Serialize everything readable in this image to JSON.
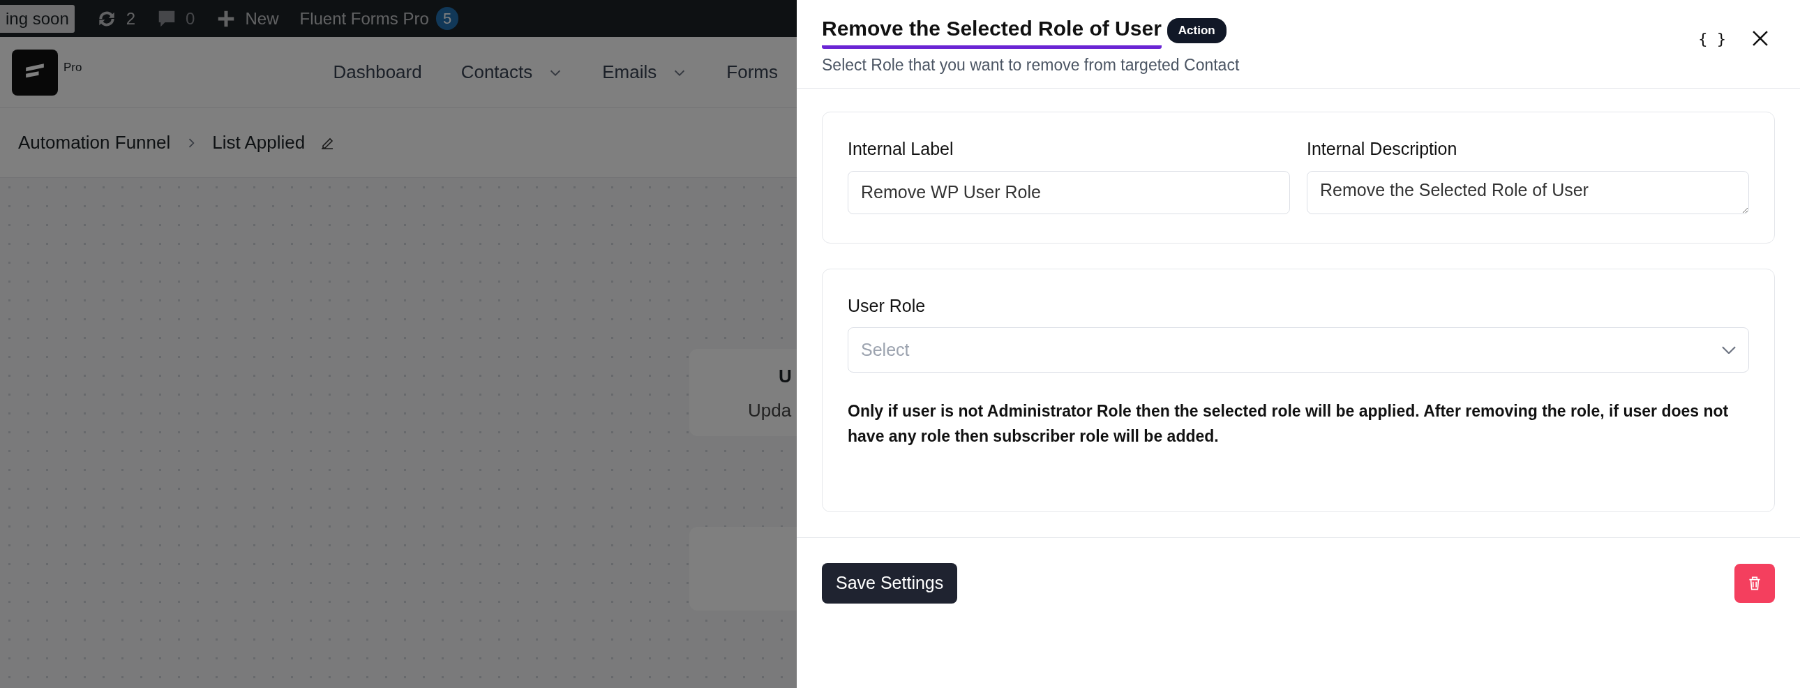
{
  "admin_bar": {
    "items": [
      {
        "kind": "badge",
        "label": "ing soon"
      },
      {
        "kind": "updates",
        "label": "2"
      },
      {
        "kind": "comments",
        "label": "0"
      },
      {
        "kind": "new",
        "label": "New"
      },
      {
        "kind": "plugin",
        "label": "Fluent Forms Pro",
        "count": "5"
      }
    ]
  },
  "nav": {
    "logo_label": "Pro",
    "items": [
      {
        "label": "Dashboard",
        "dropdown": false
      },
      {
        "label": "Contacts",
        "dropdown": true
      },
      {
        "label": "Emails",
        "dropdown": true
      },
      {
        "label": "Forms",
        "dropdown": false
      }
    ]
  },
  "breadcrumb": [
    "Automation Funnel",
    "List Applied"
  ],
  "canvas": {
    "nodes": [
      {
        "title": "U",
        "subtitle": "Upda"
      }
    ]
  },
  "drawer": {
    "title": "Remove the Selected Role of User",
    "tag": "Action",
    "subtitle": "Select Role that you want to remove from targeted Contact",
    "code_button": "{ }",
    "fields": [
      {
        "label": "Internal Label",
        "kind": "input",
        "value": "Remove WP User Role"
      },
      {
        "label": "Internal Description",
        "kind": "textarea",
        "value": "Remove the Selected Role of User"
      }
    ],
    "role": {
      "label": "User Role",
      "placeholder": "Select",
      "note": "Only if user is not Administrator Role then the selected role will be applied. After removing the role, if user does not have any role then subscriber role will be added."
    },
    "save_button": "Save Settings"
  }
}
